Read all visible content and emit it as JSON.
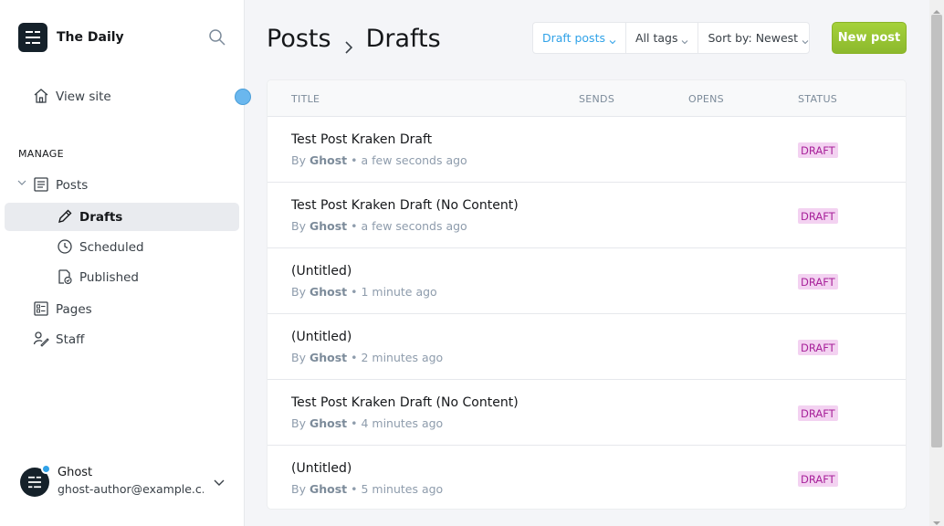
{
  "sidebar": {
    "brand_name": "The Daily",
    "view_site": "View site",
    "section_label": "MANAGE",
    "posts": "Posts",
    "drafts": "Drafts",
    "scheduled": "Scheduled",
    "published": "Published",
    "pages": "Pages",
    "staff": "Staff",
    "user": {
      "name": "Ghost",
      "email": "ghost-author@example.c..."
    }
  },
  "header": {
    "breadcrumb_root": "Posts",
    "breadcrumb_current": "Drafts",
    "filters": [
      "Draft posts",
      "All tags",
      "Sort by: Newest"
    ],
    "new_post": "New post"
  },
  "table": {
    "columns": [
      "TITLE",
      "SENDS",
      "OPENS",
      "STATUS"
    ],
    "by_label": "By",
    "rows": [
      {
        "title": "Test Post Kraken Draft",
        "author": "Ghost",
        "time": "a few seconds ago",
        "status": "DRAFT"
      },
      {
        "title": "Test Post Kraken Draft (No Content)",
        "author": "Ghost",
        "time": "a few seconds ago",
        "status": "DRAFT"
      },
      {
        "title": "(Untitled)",
        "author": "Ghost",
        "time": "1 minute ago",
        "status": "DRAFT"
      },
      {
        "title": "(Untitled)",
        "author": "Ghost",
        "time": "2 minutes ago",
        "status": "DRAFT"
      },
      {
        "title": "Test Post Kraken Draft (No Content)",
        "author": "Ghost",
        "time": "4 minutes ago",
        "status": "DRAFT"
      },
      {
        "title": "(Untitled)",
        "author": "Ghost",
        "time": "5 minutes ago",
        "status": "DRAFT"
      }
    ]
  },
  "colors": {
    "accent": "#30a2e8",
    "primary_button": "#9fcc34",
    "draft_badge_bg": "#f3d2f1",
    "draft_badge_text": "#a8229a"
  }
}
